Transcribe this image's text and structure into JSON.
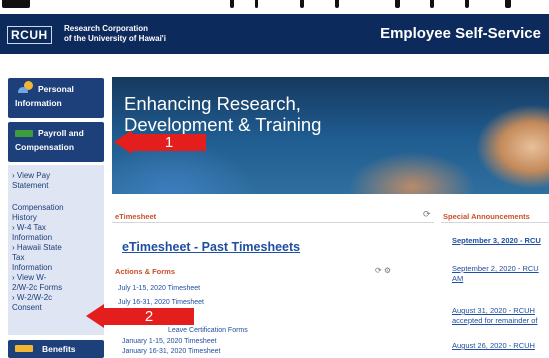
{
  "header": {
    "logo_text": "RCUH",
    "org_line1": "Research Corporation",
    "org_line2": "of the University of Hawai'i",
    "app_title": "Employee Self-Service"
  },
  "sidebar": {
    "personal_info_label_1": "Personal",
    "personal_info_label_2": "Information",
    "payroll_label_1": "Payroll and",
    "payroll_label_2": "Compensation",
    "items": [
      "› View Pay",
      "Statement",
      "Compensation",
      "History",
      "› W-4 Tax",
      "Information",
      "› Hawaii State",
      "Tax",
      "Information",
      "› View W-",
      "2/W-2c Forms",
      "› W-2/W-2c",
      "Consent"
    ],
    "benefits_label": "Benefits"
  },
  "banner": {
    "line1": "Enhancing Research,",
    "line2": "Development & Training"
  },
  "annotations": {
    "one": "1",
    "two": "2",
    "color": "#e41d1d"
  },
  "etimesheet": {
    "panel_label": "eTimesheet",
    "refresh_icon": "refresh-icon",
    "title": "eTimesheet - Past Timesheets",
    "actions_label": "Actions & Forms",
    "toolbar_icons": "⟳  ⚙",
    "lines": [
      "July 1-15, 2020 Timesheet",
      "July 16-31, 2020 Timesheet",
      "Leave Certification Forms",
      "January 1-15, 2020 Timesheet",
      "January 16-31, 2020 Timesheet"
    ]
  },
  "special": {
    "label": "Special Announcements",
    "items": [
      "September 3, 2020 - RCU",
      "September 2, 2020 - RCU",
      "AM",
      "August 31, 2020 - RCUH",
      "accepted for remainder of",
      "August 26, 2020 - RCUH"
    ]
  }
}
